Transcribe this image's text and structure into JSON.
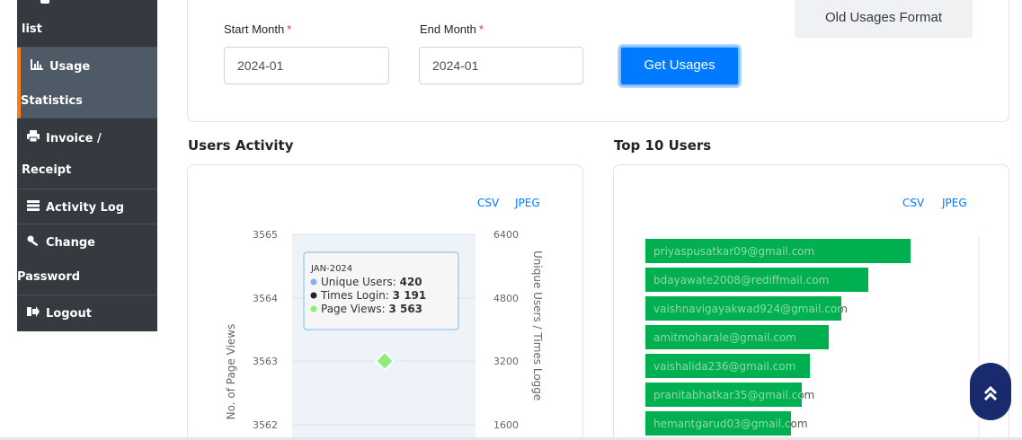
{
  "sidebar": {
    "items": [
      {
        "id": "list",
        "icon": "",
        "line1": "list",
        "line2": ""
      },
      {
        "id": "usage",
        "icon": "bar-chart-icon",
        "line1": "Usage",
        "line2": "Statistics"
      },
      {
        "id": "invoice",
        "icon": "print-icon",
        "line1": "Invoice /",
        "line2": "Receipt"
      },
      {
        "id": "activity",
        "icon": "table-list-icon",
        "line1": "Activity Log",
        "line2": ""
      },
      {
        "id": "password",
        "icon": "key-icon",
        "line1": "Change",
        "line2": "Password"
      },
      {
        "id": "logout",
        "icon": "sign-out-icon",
        "line1": "Logout",
        "line2": ""
      }
    ]
  },
  "filters": {
    "start_label": "Start Month",
    "end_label": "End Month",
    "required_mark": "*",
    "start_value": "2024-01",
    "end_value": "2024-01",
    "get_button": "Get Usages",
    "old_button": "Old Usages Format"
  },
  "users_activity": {
    "title": "Users Activity",
    "csv": "CSV",
    "jpeg": "JPEG",
    "left_axis_label": "No. of Page Views",
    "right_axis_label": "Unique Users / Times Logge",
    "left_ticks": [
      "3565",
      "3564",
      "3563",
      "3562"
    ],
    "right_ticks": [
      "6400",
      "4800",
      "3200",
      "1600"
    ],
    "tooltip": {
      "title": "JAN-2024",
      "rows": [
        {
          "label": "Unique Users:",
          "value": "420",
          "color": "#7cb5ec"
        },
        {
          "label": "Times Login:",
          "value": "3 191",
          "color": "#222222"
        },
        {
          "label": "Page Views:",
          "value": "3 563",
          "color": "#90ed7d"
        }
      ]
    },
    "colors": {
      "marker": "#90ed7d"
    }
  },
  "top_users": {
    "title": "Top 10 Users",
    "csv": "CSV",
    "jpeg": "JPEG",
    "bar_color": "#00b050",
    "label_color": "#8fd9a8",
    "users": [
      {
        "email": "priyaspusatkar09@gmail.com",
        "value": 100
      },
      {
        "email": "bdayawate2008@rediffmail.com",
        "value": 84
      },
      {
        "email": "vaishnavigayakwad924@gmail.com",
        "value": 74
      },
      {
        "email": "amitmoharale@gmail.com",
        "value": 69
      },
      {
        "email": "vaishalida236@gmail.com",
        "value": 62
      },
      {
        "email": "pranitabhatkar35@gmail.com",
        "value": 59
      },
      {
        "email": "hemantgarud03@gmail.com",
        "value": 55
      }
    ]
  }
}
